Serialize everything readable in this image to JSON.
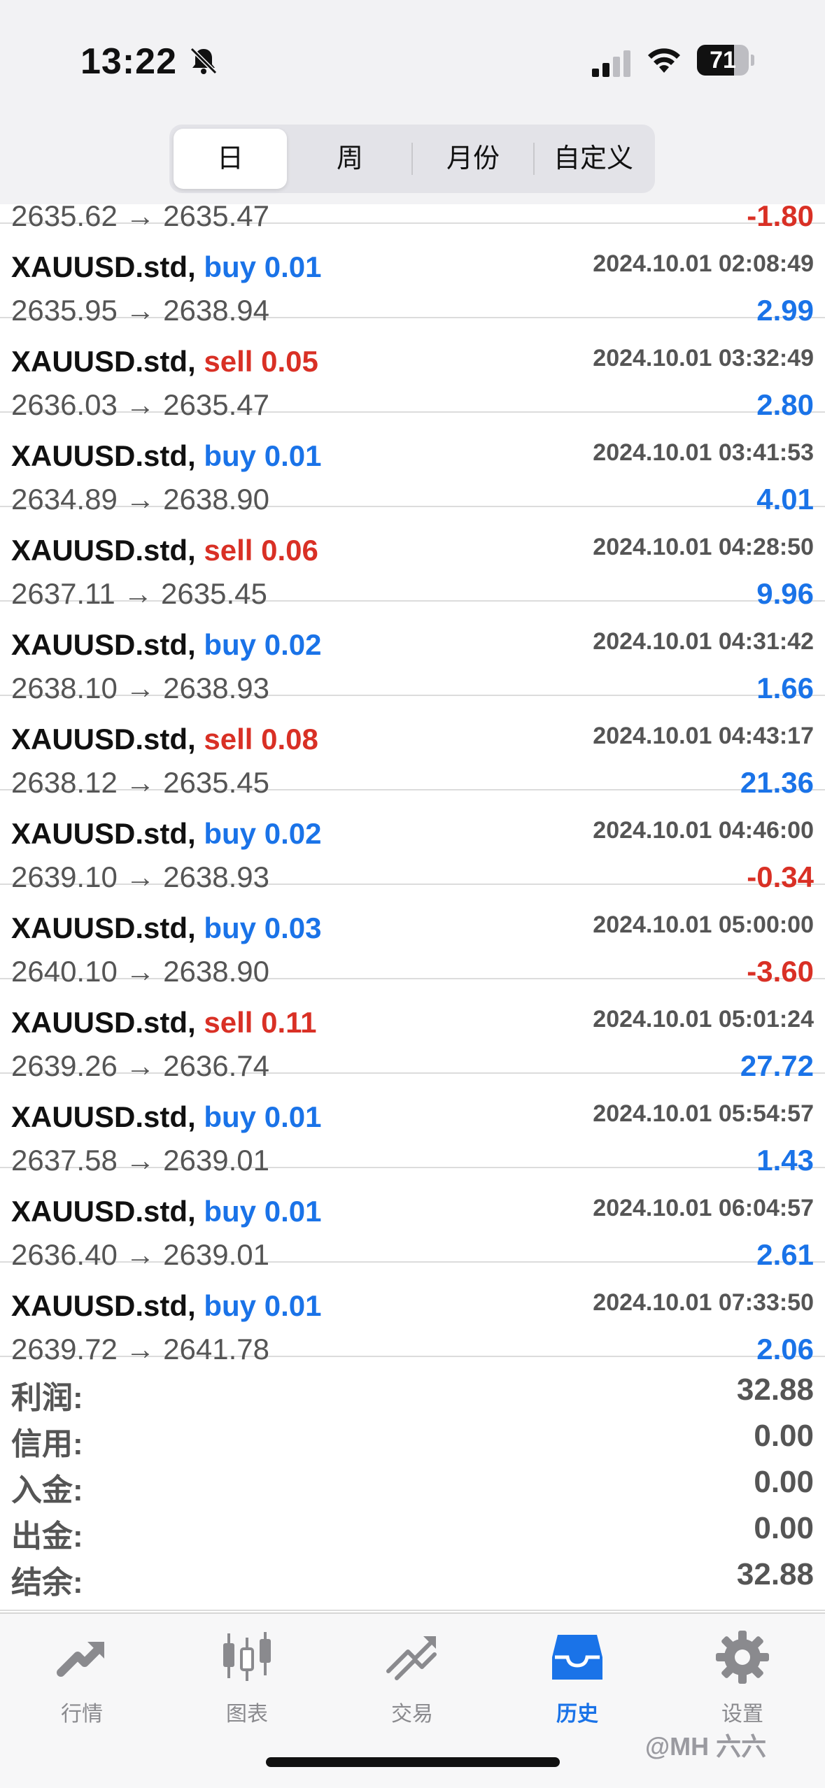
{
  "status_bar": {
    "time": "13:22",
    "battery": "71",
    "battery_level": 0.71
  },
  "segments": [
    {
      "label": "日",
      "active": true
    },
    {
      "label": "周",
      "active": false
    },
    {
      "label": "月份",
      "active": false
    },
    {
      "label": "自定义",
      "active": false
    }
  ],
  "partial_row": {
    "prices": "2635.62 → 2635.47",
    "profit": "-1.80"
  },
  "trades": [
    {
      "symbol": "XAUUSD.std,",
      "direction": "buy 0.01",
      "type": "buy",
      "time": "2024.10.01 02:08:49",
      "prices": "2635.95 → 2638.94",
      "profit": "2.99",
      "sign": "pos"
    },
    {
      "symbol": "XAUUSD.std,",
      "direction": "sell 0.05",
      "type": "sell",
      "time": "2024.10.01 03:32:49",
      "prices": "2636.03 → 2635.47",
      "profit": "2.80",
      "sign": "pos"
    },
    {
      "symbol": "XAUUSD.std,",
      "direction": "buy 0.01",
      "type": "buy",
      "time": "2024.10.01 03:41:53",
      "prices": "2634.89 → 2638.90",
      "profit": "4.01",
      "sign": "pos"
    },
    {
      "symbol": "XAUUSD.std,",
      "direction": "sell 0.06",
      "type": "sell",
      "time": "2024.10.01 04:28:50",
      "prices": "2637.11 → 2635.45",
      "profit": "9.96",
      "sign": "pos"
    },
    {
      "symbol": "XAUUSD.std,",
      "direction": "buy 0.02",
      "type": "buy",
      "time": "2024.10.01 04:31:42",
      "prices": "2638.10 → 2638.93",
      "profit": "1.66",
      "sign": "pos"
    },
    {
      "symbol": "XAUUSD.std,",
      "direction": "sell 0.08",
      "type": "sell",
      "time": "2024.10.01 04:43:17",
      "prices": "2638.12 → 2635.45",
      "profit": "21.36",
      "sign": "pos"
    },
    {
      "symbol": "XAUUSD.std,",
      "direction": "buy 0.02",
      "type": "buy",
      "time": "2024.10.01 04:46:00",
      "prices": "2639.10 → 2638.93",
      "profit": "-0.34",
      "sign": "neg"
    },
    {
      "symbol": "XAUUSD.std,",
      "direction": "buy 0.03",
      "type": "buy",
      "time": "2024.10.01 05:00:00",
      "prices": "2640.10 → 2638.90",
      "profit": "-3.60",
      "sign": "neg"
    },
    {
      "symbol": "XAUUSD.std,",
      "direction": "sell 0.11",
      "type": "sell",
      "time": "2024.10.01 05:01:24",
      "prices": "2639.26 → 2636.74",
      "profit": "27.72",
      "sign": "pos"
    },
    {
      "symbol": "XAUUSD.std,",
      "direction": "buy 0.01",
      "type": "buy",
      "time": "2024.10.01 05:54:57",
      "prices": "2637.58 → 2639.01",
      "profit": "1.43",
      "sign": "pos"
    },
    {
      "symbol": "XAUUSD.std,",
      "direction": "buy 0.01",
      "type": "buy",
      "time": "2024.10.01 06:04:57",
      "prices": "2636.40 → 2639.01",
      "profit": "2.61",
      "sign": "pos"
    },
    {
      "symbol": "XAUUSD.std,",
      "direction": "buy 0.01",
      "type": "buy",
      "time": "2024.10.01 07:33:50",
      "prices": "2639.72 → 2641.78",
      "profit": "2.06",
      "sign": "pos"
    }
  ],
  "summary": [
    {
      "label": "利润:",
      "value": "32.88"
    },
    {
      "label": "信用:",
      "value": "0.00"
    },
    {
      "label": "入金:",
      "value": "0.00"
    },
    {
      "label": "出金:",
      "value": "0.00"
    },
    {
      "label": "结余:",
      "value": "32.88"
    }
  ],
  "tabs": [
    {
      "label": "行情",
      "icon": "quotes-icon",
      "active": false
    },
    {
      "label": "图表",
      "icon": "chart-icon",
      "active": false
    },
    {
      "label": "交易",
      "icon": "trade-icon",
      "active": false
    },
    {
      "label": "历史",
      "icon": "history-icon",
      "active": true
    },
    {
      "label": "设置",
      "icon": "settings-icon",
      "active": false
    }
  ],
  "colors": {
    "buy": "#1a73e8",
    "sell": "#d93025",
    "active_tab": "#1a73e8"
  },
  "watermark": "@MH 六六"
}
